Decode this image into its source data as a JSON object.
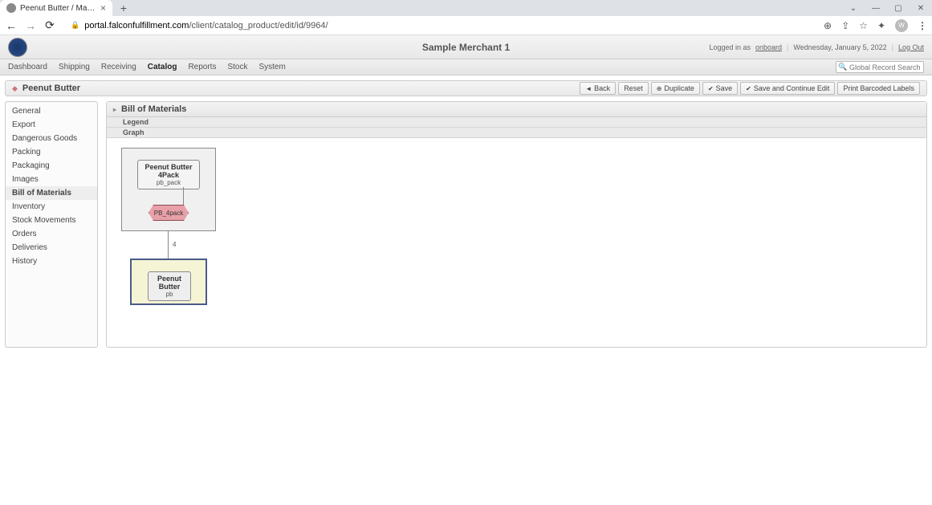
{
  "browser": {
    "tab_title": "Peenut Butter / Manage Produc",
    "url_domain": "portal.falconfulfillment.com",
    "url_path": "/client/catalog_product/edit/id/9964/",
    "avatar_initial": "W"
  },
  "header": {
    "merchant": "Sample Merchant 1",
    "logged_in_prefix": "Logged in as",
    "logged_in_user": "onboard",
    "date": "Wednesday, January 5, 2022",
    "logout": "Log Out"
  },
  "nav": {
    "items": [
      "Dashboard",
      "Shipping",
      "Receiving",
      "Catalog",
      "Reports",
      "Stock",
      "System"
    ],
    "active_index": 3,
    "search_placeholder": "Global Record Search"
  },
  "page": {
    "title": "Peenut Butter",
    "actions": {
      "back": "Back",
      "reset": "Reset",
      "duplicate": "Duplicate",
      "save": "Save",
      "save_continue": "Save and Continue Edit",
      "print": "Print Barcoded Labels"
    }
  },
  "sidebar": {
    "items": [
      "General",
      "Export",
      "Dangerous Goods",
      "Packing",
      "Packaging",
      "Images",
      "Bill of Materials",
      "Inventory",
      "Stock Movements",
      "Orders",
      "Deliveries",
      "History"
    ],
    "active_index": 6
  },
  "panel": {
    "title": "Bill of Materials",
    "sub1": "Legend",
    "sub2": "Graph"
  },
  "graph": {
    "parent_name": "Peenut Butter 4Pack",
    "parent_sku": "pb_pack",
    "hex_label": "PB_4pack",
    "edge_qty": "4",
    "child_name": "Peenut Butter",
    "child_sku": "pb"
  }
}
